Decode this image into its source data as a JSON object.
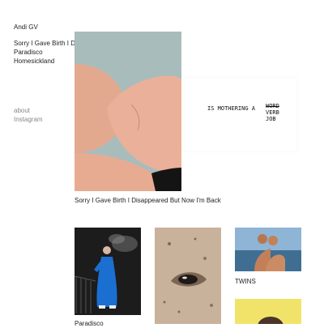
{
  "sidebar": {
    "artist_name": "Andi GV",
    "projects": [
      "Sorry I Gave Birth I Disappeared But Now I'm Back",
      "Paradisco",
      "Homesickland"
    ],
    "links": [
      "about",
      "Instagram"
    ]
  },
  "featured": {
    "caption": "Sorry I Gave Birth I Disappeared But Now I'm Back",
    "note": {
      "line1": "IS MOTHERING A",
      "crossed_word": "WORD",
      "replacement_word": "VERB",
      "line2": "JOB"
    }
  },
  "grid": {
    "items": [
      {
        "caption": "Paradisco"
      },
      {
        "caption": ""
      },
      {
        "caption": "TWINS"
      },
      {
        "caption": ""
      }
    ]
  },
  "colors": {
    "background": "#ffffff",
    "text": "#222222",
    "link_muted": "#888888"
  }
}
